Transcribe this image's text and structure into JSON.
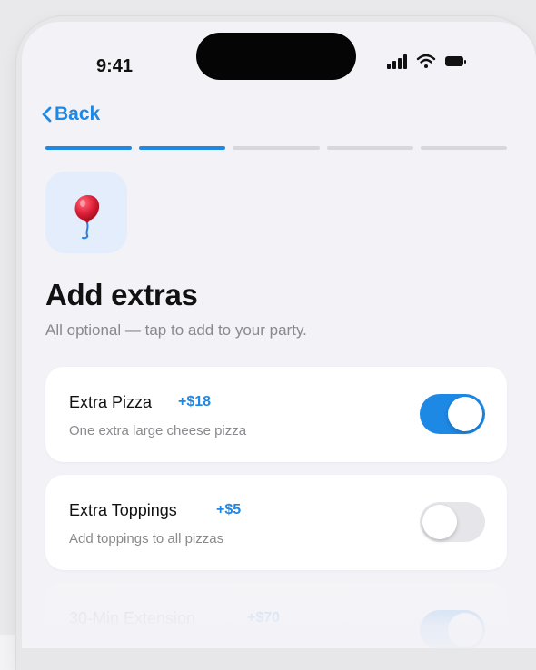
{
  "status_bar": {
    "time": "9:41",
    "icons": [
      "signal-icon",
      "wifi-icon",
      "battery-icon"
    ]
  },
  "nav": {
    "back_label": "Back",
    "back_icon": "chevron-left-icon"
  },
  "progress": {
    "total_steps": 5,
    "completed_steps": 2,
    "accent": "#1e88e5"
  },
  "hero": {
    "icon": "balloon-icon",
    "tile_color": "#e3edfc"
  },
  "header": {
    "title": "Add extras",
    "subtitle": "All optional — tap to add to your party."
  },
  "options": [
    {
      "name": "Extra Pizza",
      "price": "+$18",
      "description": "One extra large cheese pizza",
      "enabled": true
    },
    {
      "name": "Extra Toppings",
      "price": "+$5",
      "description": "Add toppings to all pizzas",
      "enabled": false
    },
    {
      "name": "30-Min Extension",
      "price": "+$70",
      "description": "",
      "enabled": true
    }
  ]
}
